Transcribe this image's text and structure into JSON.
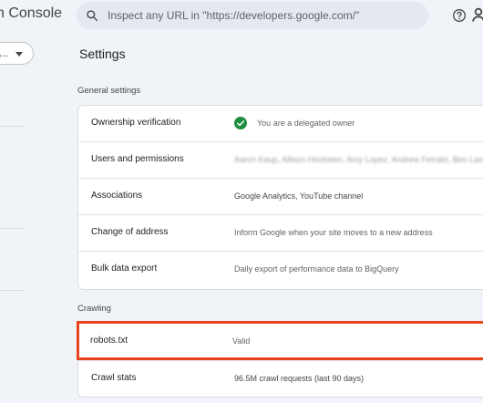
{
  "header": {
    "app_title": "n Console",
    "search_placeholder": "Inspect any URL in \"https://developers.google.com/\"",
    "help_icon": "help-circle-icon",
    "account_icon": "account-icon"
  },
  "sidebar": {
    "property_label": "..."
  },
  "page": {
    "title": "Settings"
  },
  "general_settings": {
    "title": "General settings",
    "rows": [
      {
        "label": "Ownership verification",
        "value": "You are a delegated owner",
        "icon": "check-circle-icon"
      },
      {
        "label": "Users and permissions",
        "value": "Aaron Kaup, Allison Hocksten, Amy Lopez, Andrew Ferrato, Ben Lamon..."
      },
      {
        "label": "Associations",
        "value": "Google Analytics, YouTube channel"
      },
      {
        "label": "Change of address",
        "value": "Inform Google when your site moves to a new address"
      },
      {
        "label": "Bulk data export",
        "value": "Daily export of performance data to BigQuery"
      }
    ]
  },
  "crawling": {
    "title": "Crawling",
    "rows": [
      {
        "label": "robots.txt",
        "value": "Valid"
      },
      {
        "label": "Crawl stats",
        "value": "96.5M crawl requests (last 90 days)"
      }
    ]
  },
  "colors": {
    "background": "#f0f4f9",
    "search_bar": "#e3e8f1",
    "highlight": "#e8431f",
    "check": "#1e8e3e"
  }
}
